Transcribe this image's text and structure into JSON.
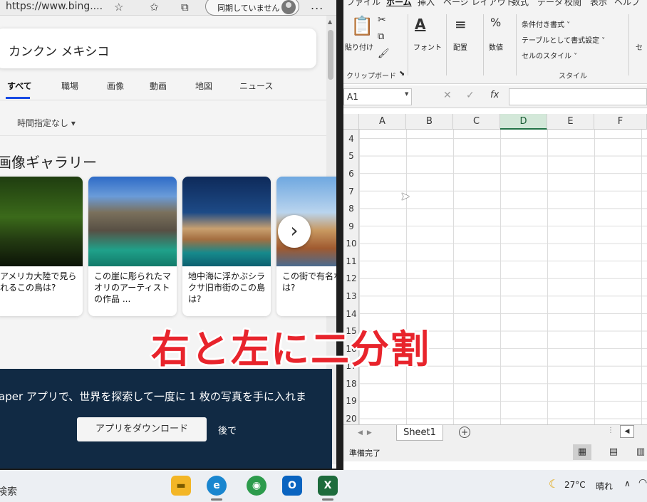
{
  "browser": {
    "url": "https://www.bing....",
    "sync_label": "同期していません",
    "more_label": "...",
    "search_query": "カンクン メキシコ",
    "tabs": [
      {
        "label": "すべて"
      },
      {
        "label": "職場"
      },
      {
        "label": "画像"
      },
      {
        "label": "動画"
      },
      {
        "label": "地図"
      },
      {
        "label": "ニュース"
      }
    ],
    "time_filter": "時間指定なし ▾",
    "gallery_title": "画像ギャラリー",
    "cards": [
      {
        "caption": "アメリカ大陸で見られるこの鳥は?"
      },
      {
        "caption": "この崖に彫られたマオリのアーティストの作品 ..."
      },
      {
        "caption": "地中海に浮かぶシラクサ旧市街のこの島は?"
      },
      {
        "caption": "この街で有名な祭りは?"
      }
    ],
    "next_arrow": "›",
    "promo": {
      "text": "aper アプリで、世界を探索して一度に 1 枚の写真を手に入れま",
      "download_label": "アプリをダウンロード",
      "later_label": "後で"
    }
  },
  "excel": {
    "ribbon_tabs": [
      "ファイル",
      "ホーム",
      "挿入",
      "ページ レイアウト",
      "数式",
      "データ",
      "校閲",
      "表示",
      "ヘルプ"
    ],
    "active_tab": "ホーム",
    "ribbon": {
      "paste_label": "貼り付け",
      "clipboard_group": "クリップボード",
      "font_label": "フォント",
      "align_label": "配置",
      "number_label": "数値",
      "conditional_format": "条件付き書式 ˅",
      "format_as_table": "テーブルとして書式設定 ˅",
      "cell_styles": "セルのスタイル ˅",
      "styles_group": "スタイル",
      "cells_label": "セ"
    },
    "name_box": "A1",
    "fx": "fx",
    "columns": [
      "A",
      "B",
      "C",
      "D",
      "E",
      "F"
    ],
    "selected_column": "D",
    "rows": [
      "4",
      "5",
      "6",
      "7",
      "8",
      "9",
      "10",
      "11",
      "12",
      "13",
      "14",
      "15",
      "16",
      "17",
      "18",
      "19",
      "20"
    ],
    "sheet_tab": "Sheet1",
    "add_sheet": "+",
    "status": "準備完了"
  },
  "taskbar": {
    "search_label": "検索",
    "apps": [
      {
        "name": "file-explorer"
      },
      {
        "name": "edge"
      },
      {
        "name": "chrome"
      },
      {
        "name": "outlook",
        "label": "O"
      },
      {
        "name": "excel",
        "label": "X"
      }
    ],
    "temperature": "27°C",
    "weather": "晴れ"
  },
  "overlay_caption": "右と左に二分割"
}
